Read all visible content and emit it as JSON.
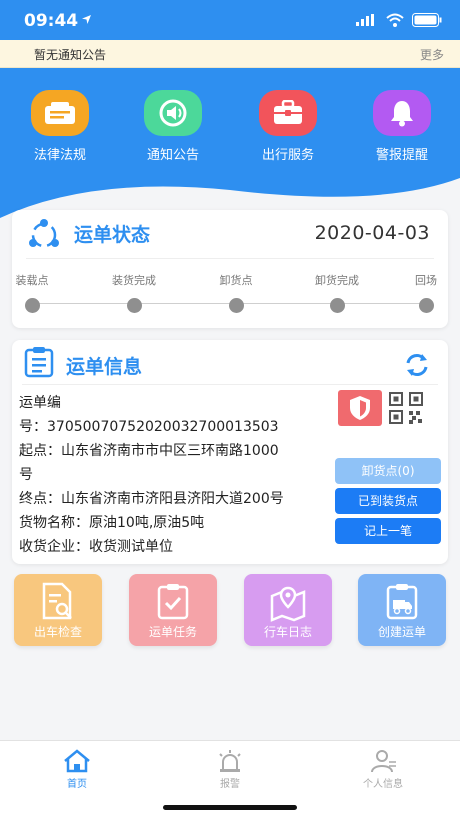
{
  "status_bar": {
    "time": "09:44"
  },
  "notice": {
    "text": "暂无通知公告",
    "more": "更多"
  },
  "quick_menu": [
    {
      "label": "法律法规",
      "color": "#f5a623"
    },
    {
      "label": "通知公告",
      "color": "#4cd89a"
    },
    {
      "label": "出行服务",
      "color": "#f2545b"
    },
    {
      "label": "警报提醒",
      "color": "#b35af2"
    }
  ],
  "waybill_status": {
    "title": "运单状态",
    "date": "2020-04-03",
    "steps": [
      "装载点",
      "装货完成",
      "卸货点",
      "卸货完成",
      "回场"
    ]
  },
  "waybill_info": {
    "title": "运单信息",
    "lines": [
      "运单编",
      "号：37050070752020032700013503",
      "起点：山东省济南市市中区三环南路1000",
      "号",
      "终点：山东省济南市济阳县济阳大道200号",
      "货物名称：原油10吨,原油5吨",
      "收货企业：收货测试单位"
    ],
    "buttons": {
      "unload": "卸货点(0)",
      "arrived": "已到装货点",
      "record": "记上一笔"
    }
  },
  "shortcuts": [
    {
      "label": "出车检查",
      "color": "#f8c77e"
    },
    {
      "label": "运单任务",
      "color": "#f5a3a8"
    },
    {
      "label": "行车日志",
      "color": "#d79cf0"
    },
    {
      "label": "创建运单",
      "color": "#7fb4f5"
    }
  ],
  "tabs": [
    {
      "label": "首页",
      "active": true
    },
    {
      "label": "报警",
      "active": false
    },
    {
      "label": "个人信息",
      "active": false
    }
  ],
  "colors": {
    "primary": "#2e8ff0",
    "disabled_button": "#8fc2f7",
    "button": "#1c7cf5"
  }
}
